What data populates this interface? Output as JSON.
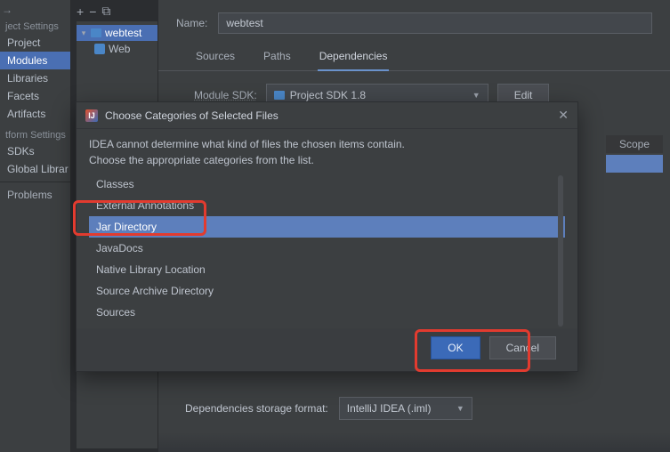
{
  "gutter": {
    "back_icon": "→",
    "heading1": "ject Settings",
    "items1": [
      "Project",
      "Modules",
      "Libraries",
      "Facets",
      "Artifacts"
    ],
    "selected1": "Modules",
    "heading2": "tform Settings",
    "items2": [
      "SDKs",
      "Global Librar"
    ],
    "heading3": "Problems"
  },
  "tree": {
    "top_actions": {
      "add": "+",
      "remove": "−",
      "copy": "⧉"
    },
    "root": "webtest",
    "child": "Web"
  },
  "content": {
    "name_label": "Name:",
    "name_value": "webtest",
    "tabs": [
      "Sources",
      "Paths",
      "Dependencies"
    ],
    "active_tab": "Dependencies",
    "sdk_label": "Module SDK:",
    "sdk_value": "Project SDK 1.8",
    "edit_btn": "Edit",
    "table": {
      "scope_header": "Scope"
    },
    "storage_label": "Dependencies storage format:",
    "storage_value": "IntelliJ IDEA (.iml)"
  },
  "dialog": {
    "title": "Choose Categories of Selected Files",
    "badge": "IJ",
    "msg1": "IDEA cannot determine what kind of files the chosen items contain.",
    "msg2": "Choose the appropriate categories from the list.",
    "options": [
      "Classes",
      "External Annotations",
      "Jar Directory",
      "JavaDocs",
      "Native Library Location",
      "Source Archive Directory",
      "Sources"
    ],
    "selected_option": "Jar Directory",
    "ok": "OK",
    "cancel": "Cancel"
  }
}
